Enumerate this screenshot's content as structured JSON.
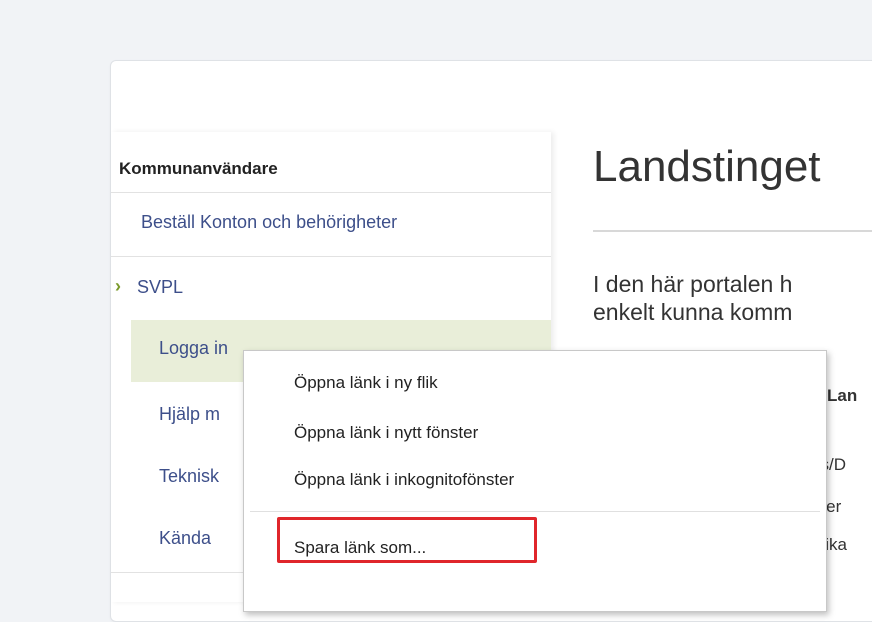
{
  "sidebar": {
    "heading": "Kommunanvändare",
    "items": [
      {
        "label": "Beställ Konton och behörigheter"
      },
      {
        "label": "SVPL",
        "chevron": "›"
      },
      {
        "label": "Logga in"
      },
      {
        "label": "Hjälp m"
      },
      {
        "label": "Teknisk"
      },
      {
        "label": "Kända"
      }
    ]
  },
  "main": {
    "title": "Landstinget",
    "intro_line1": "I den här portalen h",
    "intro_line2": "enkelt kunna komm",
    "peek_text": [
      "Lan",
      "vs/D",
      "mer",
      "plika"
    ]
  },
  "context_menu": {
    "items": [
      "Öppna länk i ny flik",
      "Öppna länk i nytt fönster",
      "Öppna länk i inkognitofönster",
      "Spara länk som..."
    ]
  },
  "colors": {
    "link": "#3d4f8a",
    "active_bg": "#e9eed9",
    "chevron": "#7a9a2a",
    "highlight": "#e0262b"
  }
}
